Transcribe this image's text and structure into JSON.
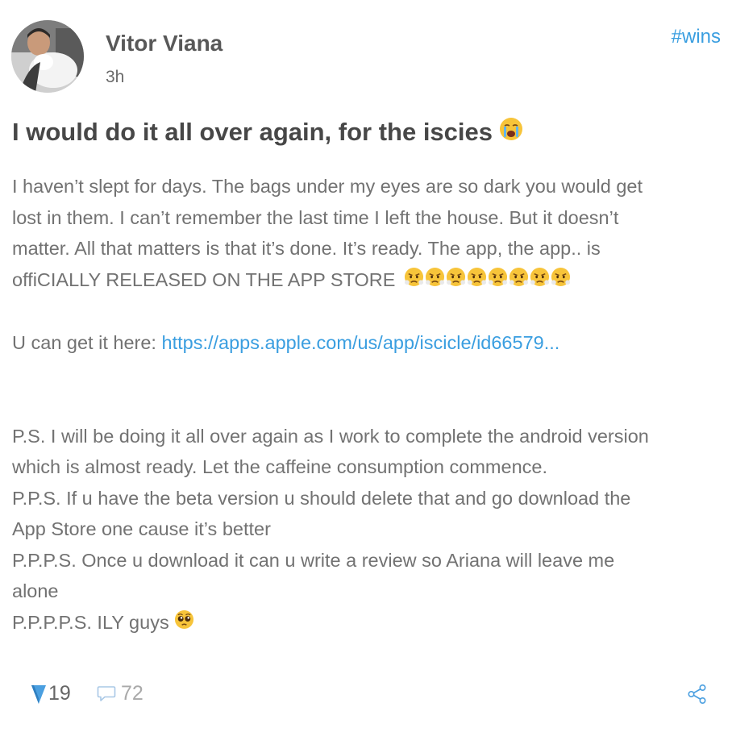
{
  "author": {
    "name": "Vitor Viana",
    "timestamp": "3h"
  },
  "tag": "#wins",
  "post": {
    "title": "I would do it all over again, for the iscies",
    "title_emoji": "loudly-crying-face",
    "body": {
      "line1": "I haven’t slept for days. The bags under my eyes are so dark you would get",
      "line2": "lost in them. I can’t remember the last time I left the house. But it doesn’t",
      "line3": "matter. All that matters is that it’s done. It’s ready. The app, the app.. is",
      "line4": "offiCIALLY RELEASED ON THE APP STORE",
      "line4_emoji": "face-with-steam-from-nose x8",
      "link_prefix": "U can get it here: ",
      "link_text": "https://apps.apple.com/us/app/iscicle/id66579...",
      "ps1": "P.S. I will be doing it all over again as I work to complete the android version",
      "ps2": "which is almost ready. Let the caffeine consumption commence.",
      "ps3": "P.P.S. If u have the beta version u should delete that and go download the",
      "ps4": "App Store one cause it’s better",
      "ps5": "P.P.P.S. Once u download it can u write a review so Ariana will leave me",
      "ps6": "alone",
      "ps7": "P.P.P.P.S. ILY guys",
      "ps7_emoji": "pleading-face"
    }
  },
  "footer": {
    "votes": "19",
    "comments": "72"
  },
  "icons": {
    "vote": "upvote-triangle-icon",
    "comment": "comment-bubble-icon",
    "share": "share-icon"
  },
  "colors": {
    "accent": "#3a9ee0",
    "vote_blue": "#4a9fe0",
    "text": "#727272",
    "title": "#474747",
    "emoji_yellow": "#f7c43a"
  }
}
